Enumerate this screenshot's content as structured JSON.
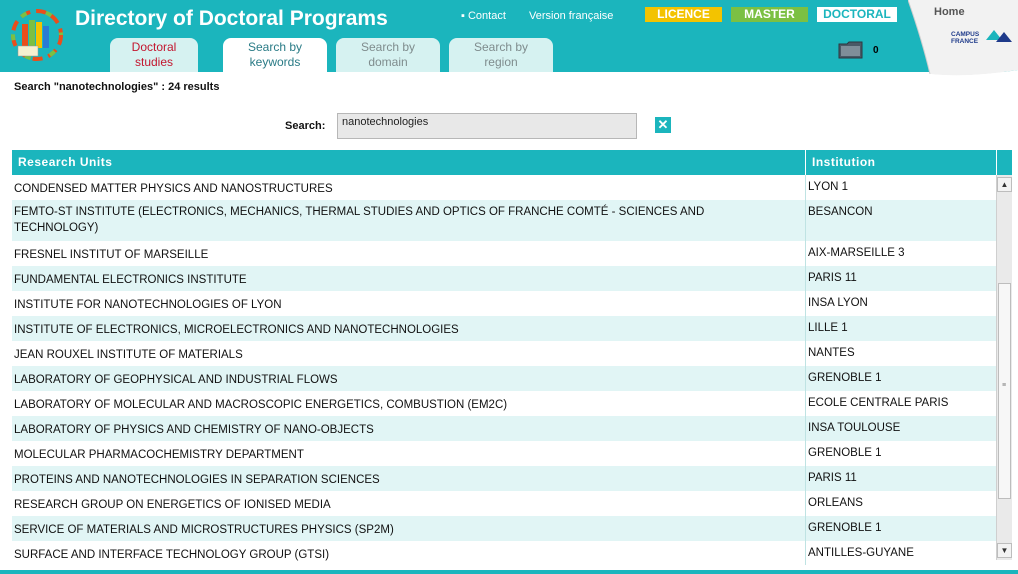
{
  "header": {
    "title": "Directory of Doctoral Programs",
    "contact_label": "Contact",
    "french_label": "Version française",
    "badges": {
      "licence": "LICENCE",
      "master": "MASTER",
      "doctoral": "DOCTORAL"
    },
    "basket_count": "0",
    "home_label": "Home",
    "tabs": [
      {
        "line1": "Doctoral",
        "line2": "studies"
      },
      {
        "line1": "Search by",
        "line2": "keywords"
      },
      {
        "line1": "Search by",
        "line2": "domain"
      },
      {
        "line1": "Search by",
        "line2": "region"
      }
    ],
    "colors": {
      "teal": "#1bb5bd",
      "licence": "#f3c300",
      "master": "#7bc043",
      "doctoral_text": "#1bb5bd",
      "red_tab": "#c3162f"
    }
  },
  "search": {
    "summary": "Search \"nanotechnologies\" : 24 results",
    "label": "Search:",
    "value": "nanotechnologies"
  },
  "table": {
    "headers": {
      "units": "Research Units",
      "institution": "Institution"
    },
    "rows": [
      {
        "unit": "CONDENSED MATTER PHYSICS AND NANOSTRUCTURES",
        "institution": "LYON 1"
      },
      {
        "unit": "FEMTO-ST INSTITUTE (ELECTRONICS, MECHANICS, THERMAL STUDIES AND OPTICS OF FRANCHE COMTÉ - SCIENCES AND TECHNOLOGY)",
        "institution": "BESANCON"
      },
      {
        "unit": "FRESNEL INSTITUT OF MARSEILLE",
        "institution": "AIX-MARSEILLE 3"
      },
      {
        "unit": "FUNDAMENTAL ELECTRONICS INSTITUTE",
        "institution": "PARIS 11"
      },
      {
        "unit": "INSTITUTE FOR NANOTECHNOLOGIES OF LYON",
        "institution": "INSA LYON"
      },
      {
        "unit": "INSTITUTE OF ELECTRONICS, MICROELECTRONICS AND NANOTECHNOLOGIES",
        "institution": "LILLE 1"
      },
      {
        "unit": "JEAN ROUXEL INSTITUTE OF MATERIALS",
        "institution": "NANTES"
      },
      {
        "unit": "LABORATORY OF GEOPHYSICAL AND INDUSTRIAL FLOWS",
        "institution": "GRENOBLE 1"
      },
      {
        "unit": "LABORATORY OF MOLECULAR AND MACROSCOPIC ENERGETICS, COMBUSTION (EM2C)",
        "institution": "ECOLE CENTRALE PARIS"
      },
      {
        "unit": "LABORATORY OF PHYSICS AND CHEMISTRY OF NANO-OBJECTS",
        "institution": "INSA TOULOUSE"
      },
      {
        "unit": "MOLECULAR PHARMACOCHEMISTRY DEPARTMENT",
        "institution": "GRENOBLE 1"
      },
      {
        "unit": "PROTEINS AND NANOTECHNOLOGIES IN SEPARATION SCIENCES",
        "institution": "PARIS 11"
      },
      {
        "unit": "RESEARCH GROUP ON ENERGETICS OF IONISED MEDIA",
        "institution": "ORLEANS"
      },
      {
        "unit": "SERVICE OF MATERIALS AND MICROSTRUCTURES PHYSICS (SP2M)",
        "institution": "GRENOBLE 1"
      },
      {
        "unit": "SURFACE AND INTERFACE TECHNOLOGY GROUP (GTSI)",
        "institution": "ANTILLES-GUYANE"
      }
    ]
  },
  "icons": {
    "logo": "books-logo-icon",
    "basket": "folder-basket-icon",
    "clear": "close-icon",
    "corner": "campus-france-logo"
  }
}
